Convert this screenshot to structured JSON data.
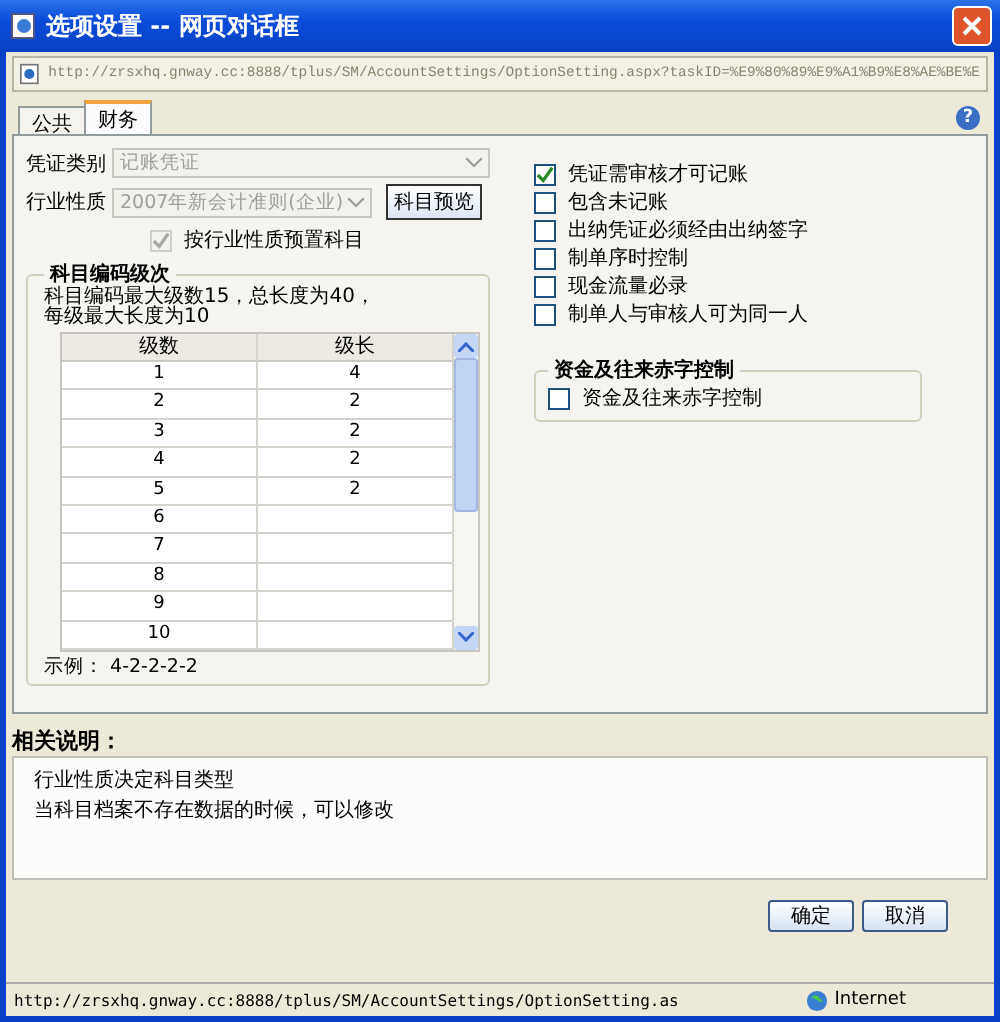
{
  "window": {
    "title": "选项设置 -- 网页对话框"
  },
  "address_bar": {
    "url": "http://zrsxhq.gnway.cc:8888/tplus/SM/AccountSettings/OptionSetting.aspx?taskID=%E9%80%89%E9%A1%B9%E8%AE%BE%E"
  },
  "tabs": [
    {
      "label": "公共",
      "selected": false
    },
    {
      "label": "财务",
      "selected": true
    }
  ],
  "help_button": "?",
  "form": {
    "fields": [
      {
        "label": "凭证类别",
        "value": "记账凭证",
        "disabled": true
      },
      {
        "label": "行业性质",
        "value": "2007年新会计准则(企业)",
        "disabled": true
      }
    ],
    "preview_button": "科目预览",
    "preset_checkbox": {
      "label": "按行业性质预置科目",
      "checked": true,
      "disabled": true
    }
  },
  "coding_levels": {
    "title": "科目编码级次",
    "note_lines": [
      "科目编码最大级数15，总长度为40，",
      "每级最大长度为10"
    ],
    "columns": [
      "级数",
      "级长"
    ],
    "rows": [
      [
        "1",
        "4"
      ],
      [
        "2",
        "2"
      ],
      [
        "3",
        "2"
      ],
      [
        "4",
        "2"
      ],
      [
        "5",
        "2"
      ],
      [
        "6",
        ""
      ],
      [
        "7",
        ""
      ],
      [
        "8",
        ""
      ],
      [
        "9",
        ""
      ],
      [
        "10",
        ""
      ]
    ],
    "example": "示例：  4-2-2-2-2"
  },
  "options": [
    {
      "label": "凭证需审核才可记账",
      "checked": true
    },
    {
      "label": "包含未记账",
      "checked": false
    },
    {
      "label": "出纳凭证必须经由出纳签字",
      "checked": false
    },
    {
      "label": "制单序时控制",
      "checked": false
    },
    {
      "label": "现金流量必录",
      "checked": false
    },
    {
      "label": "制单人与审核人可为同一人",
      "checked": false
    }
  ],
  "red_control": {
    "title": "资金及往来赤字控制",
    "option": {
      "label": "资金及往来赤字控制",
      "checked": false
    }
  },
  "description": {
    "title": "相关说明：",
    "lines": [
      "行业性质决定科目类型",
      "当科目档案不存在数据的时候，可以修改"
    ]
  },
  "buttons": [
    "确定",
    "取消"
  ],
  "status_bar": {
    "url": "http://zrsxhq.gnway.cc:8888/tplus/SM/AccountSettings/OptionSetting.as",
    "zone": "Internet"
  }
}
